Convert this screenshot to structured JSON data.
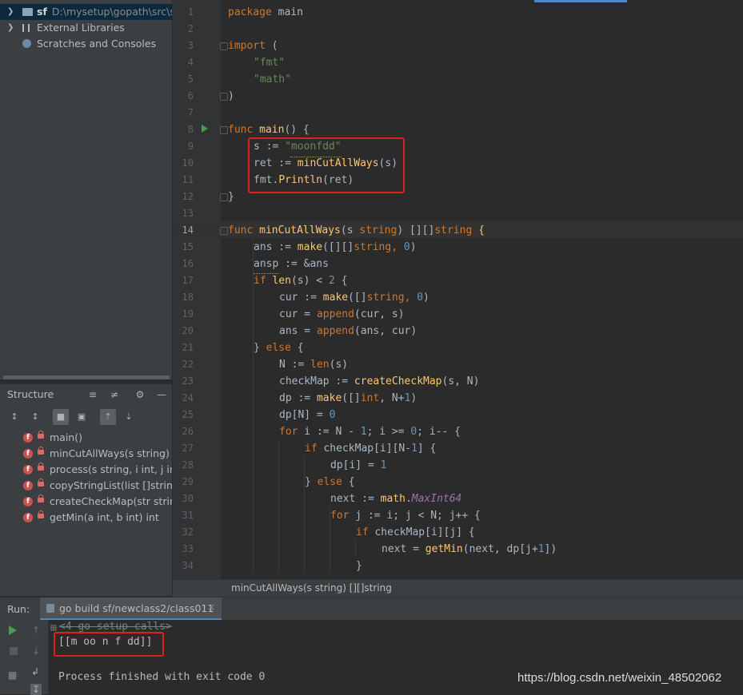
{
  "project_tree": [
    {
      "label": "sf",
      "path": "D:\\mysetup\\gopath\\src\\sf",
      "icon": "folder-icon",
      "expanded": true,
      "selected": true
    },
    {
      "label": "External Libraries",
      "icon": "library-icon",
      "expanded": false
    },
    {
      "label": "Scratches and Consoles",
      "icon": "scratches-icon"
    }
  ],
  "structure": {
    "title": "Structure",
    "items": [
      {
        "badge": "f",
        "label": "main()"
      },
      {
        "badge": "f",
        "label": "minCutAllWays(s string) [][]string"
      },
      {
        "badge": "f",
        "label": "process(s string, i int, j int, checkMap [][]bool)"
      },
      {
        "badge": "f",
        "label": "copyStringList(list []string)"
      },
      {
        "badge": "f",
        "label": "createCheckMap(str string, N int)"
      },
      {
        "badge": "f",
        "label": "getMin(a int, b int) int"
      }
    ]
  },
  "editor": {
    "line_numbers": [
      "1",
      "2",
      "3",
      "4",
      "5",
      "6",
      "7",
      "8",
      "9",
      "10",
      "11",
      "12",
      "13",
      "14",
      "15",
      "16",
      "17",
      "18",
      "19",
      "20",
      "21",
      "22",
      "23",
      "24",
      "25",
      "26",
      "27",
      "28",
      "29",
      "30",
      "31",
      "32",
      "33",
      "34"
    ],
    "current_line": "14",
    "lines": {
      "l1_kw": "package",
      "l1_rest": " main",
      "l3_kw": "import",
      "l3_rest": " (",
      "l4": "\"fmt\"",
      "l5": "\"math\"",
      "l6": ")",
      "l8_kw": "func",
      "l8_fn": " main",
      "l8_rest": "() {",
      "l9_a": "s := ",
      "l9_str": "\"moonfdd\"",
      "l10_a": "ret := ",
      "l10_fn": "minCutAllWays",
      "l10_b": "(s)",
      "l11_a": "fmt.",
      "l11_fn": "Println",
      "l11_b": "(ret)",
      "l12": "}",
      "l14_kw": "func",
      "l14_fn": " minCutAllWays",
      "l14_a": "(s ",
      "l14_t": "string",
      "l14_b": ") [][]",
      "l14_t2": "string",
      "l14_c": " {",
      "l15_a": "ans := ",
      "l15_fn": "make",
      "l15_b": "([][]",
      "l15_t": "string",
      "l15_c": ", ",
      "l15_n": "0",
      "l15_d": ")",
      "l16": "ansp := &ans",
      "l17_kw": "if",
      "l17_a": " ",
      "l17_fn": "len",
      "l17_b": "(s) < ",
      "l17_n": "2",
      "l17_c": " {",
      "l18_a": "cur := ",
      "l18_fn": "make",
      "l18_b": "([]",
      "l18_t": "string",
      "l18_c": ", ",
      "l18_n": "0",
      "l18_d": ")",
      "l19_a": "cur = ",
      "l19_fn": "append",
      "l19_b": "(cur, s)",
      "l20_a": "ans = ",
      "l20_fn": "append",
      "l20_b": "(ans, cur)",
      "l21_a": "} ",
      "l21_kw": "else",
      "l21_b": " {",
      "l22_a": "N := ",
      "l22_fn": "len",
      "l22_b": "(s)",
      "l23_a": "checkMap := ",
      "l23_fn": "createCheckMap",
      "l23_b": "(s, N)",
      "l24_a": "dp := ",
      "l24_fn": "make",
      "l24_b": "([]",
      "l24_t": "int",
      "l24_c": ", N+",
      "l24_n": "1",
      "l24_d": ")",
      "l25_a": "dp[N] = ",
      "l25_n": "0",
      "l26_kw": "for",
      "l26_a": " i := N - ",
      "l26_n": "1",
      "l26_b": "; i >= ",
      "l26_n2": "0",
      "l26_c": "; i-- {",
      "l27_kw": "if",
      "l27_a": " checkMap[i][N-",
      "l27_n": "1",
      "l27_b": "] {",
      "l28_a": "dp[i] = ",
      "l28_n": "1",
      "l29_a": "} ",
      "l29_kw": "else",
      "l29_b": " {",
      "l30_a": "next := ",
      "l30_pkg": "math",
      "l30_b": ".",
      "l30_c": "MaxInt64",
      "l31_kw": "for",
      "l31_a": " j := i; j < N; j++ {",
      "l32_kw": "if",
      "l32_a": " checkMap[i][j] {",
      "l33_a": "next = ",
      "l33_fn": "getMin",
      "l33_b": "(next, dp[j+",
      "l33_n": "1",
      "l33_c": "])",
      "l34": "}"
    }
  },
  "breadcrumb": "minCutAllWays(s string) [][]string",
  "run": {
    "label": "Run:",
    "tab": "go build sf/newclass2/class011",
    "console": [
      "<4 go setup calls>",
      "[[m oo n f dd]]",
      "Process finished with exit code 0"
    ]
  },
  "watermark": "https://blog.csdn.net/weixin_48502062",
  "colors": {
    "keyword": "#cc7832",
    "function": "#ffc66d",
    "string": "#6a8759",
    "number": "#6897bb",
    "highlight_box": "#e0201b"
  }
}
